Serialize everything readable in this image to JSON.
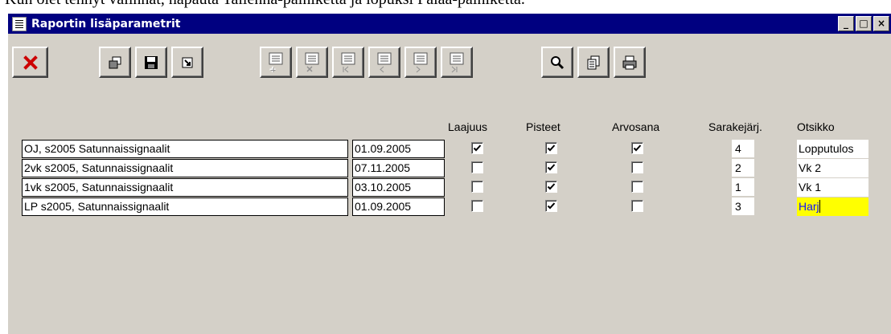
{
  "document": {
    "visible_text": "Kun olet tehnyt valinnat, napauta Tallenna-painiketta ja lopuksi Palaa-painiketta."
  },
  "window": {
    "title": "Raportin lisäparametrit",
    "controls": [
      "minimize",
      "maximize",
      "close"
    ]
  },
  "toolbar": {
    "buttons": [
      {
        "name": "close-report-button",
        "icon": "red-x-icon"
      },
      {
        "name": "copy-button",
        "icon": "copy-icon"
      },
      {
        "name": "save-button",
        "icon": "floppy-disk-icon"
      },
      {
        "name": "return-button",
        "icon": "arrow-return-icon"
      },
      {
        "name": "add-record-button",
        "icon": "doc-add-icon",
        "enabled": false
      },
      {
        "name": "delete-record-button",
        "icon": "doc-delete-icon",
        "enabled": false
      },
      {
        "name": "first-record-button",
        "icon": "doc-first-icon",
        "enabled": false
      },
      {
        "name": "prev-record-button",
        "icon": "doc-prev-icon",
        "enabled": false
      },
      {
        "name": "next-record-button",
        "icon": "doc-next-icon",
        "enabled": false
      },
      {
        "name": "last-record-button",
        "icon": "doc-last-icon",
        "enabled": false
      },
      {
        "name": "search-button",
        "icon": "magnifier-icon"
      },
      {
        "name": "document-button",
        "icon": "document-icon"
      },
      {
        "name": "print-button",
        "icon": "printer-icon"
      }
    ]
  },
  "columns": {
    "laajuus": "Laajuus",
    "pisteet": "Pisteet",
    "arvosana": "Arvosana",
    "sarakejarj": "Sarakejärj.",
    "otsikko": "Otsikko"
  },
  "rows": [
    {
      "name": "OJ, s2005 Satunnaissignaalit",
      "date": "01.09.2005",
      "laajuus": true,
      "pisteet": true,
      "arvosana": true,
      "order": "4",
      "title": "Lopputulos",
      "active": false
    },
    {
      "name": "2vk s2005, Satunnaissignaalit",
      "date": "07.11.2005",
      "laajuus": false,
      "pisteet": true,
      "arvosana": false,
      "order": "2",
      "title": "Vk 2",
      "active": false
    },
    {
      "name": "1vk s2005, Satunnaissignaalit",
      "date": "03.10.2005",
      "laajuus": false,
      "pisteet": true,
      "arvosana": false,
      "order": "1",
      "title": "Vk 1",
      "active": false
    },
    {
      "name": "LP s2005, Satunnaissignaalit",
      "date": "01.09.2005",
      "laajuus": false,
      "pisteet": true,
      "arvosana": false,
      "order": "3",
      "title": "Harj",
      "active": true
    }
  ],
  "colors": {
    "window_bg": "#d4d0c8",
    "titlebar": "#000080",
    "active_field_bg": "#ffff00",
    "active_field_text": "#1010ff"
  }
}
